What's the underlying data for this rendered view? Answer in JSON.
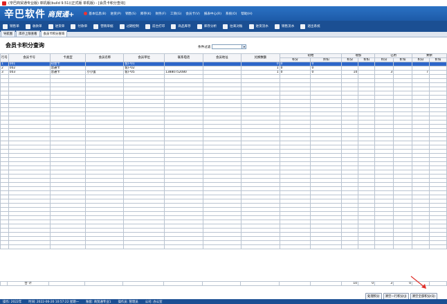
{
  "window": {
    "title": "(辛巴商贸通专业版) 单机版(build 9.51)(正式版 单机版) - [会员卡积分查询]"
  },
  "banner": {
    "logo": "辛巴软件",
    "product": "商贸通+",
    "menu": [
      "基本信息(B)",
      "进货(P)",
      "销售(S)",
      "库存(K)",
      "财务(F)",
      "工资(G)",
      "会员卡(V)",
      "报表中心(R)",
      "系统(O)",
      "帮助(H)"
    ]
  },
  "toolbar": {
    "items": [
      "销售单",
      "收款单",
      "进货单",
      "付款单",
      "营销单据",
      "过期控制",
      "前台打印",
      "商品库存",
      "库存分析",
      "往来对账",
      "进货流水",
      "销售流水",
      "退出系统"
    ]
  },
  "tabs": [
    "导航图",
    "库存上限查看",
    "会员卡积分查询"
  ],
  "page": {
    "title": "会员卡积分查询",
    "filter_label": "条件过滤",
    "filter_value": ""
  },
  "table": {
    "columns": [
      "行号",
      "会员卡号",
      "卡类型",
      "会员名称",
      "会员单位",
      "联系电话",
      "会员地址",
      "兑换数额",
      "初始",
      "增加",
      "已用",
      "剩余"
    ],
    "sub_columns": [
      "积分",
      "折扣"
    ],
    "rows": [
      {
        "no": "1",
        "card": "001",
        "type": "初会卡",
        "name": "",
        "unit": "客户01",
        "phone": "",
        "addr": "",
        "exchange": "0",
        "init_pts": "0",
        "init_disc": "0",
        "add_pts": "",
        "add_disc": "",
        "used_pts": "",
        "used_disc": "",
        "rem_pts": "",
        "rem_disc": ""
      },
      {
        "no": "2",
        "card": "002",
        "type": "普通卡",
        "name": "",
        "unit": "客户02",
        "phone": "",
        "addr": "",
        "exchange": "1",
        "init_pts": "0",
        "init_disc": "0",
        "add_pts": "",
        "add_disc": "",
        "used_pts": "",
        "used_disc": "",
        "rem_pts": "",
        "rem_disc": ""
      },
      {
        "no": "3",
        "card": "003",
        "type": "普通卡",
        "name": "小小蛋",
        "unit": "客户05",
        "phone": "13880752080",
        "addr": "",
        "exchange": "1",
        "init_pts": "0",
        "init_disc": "0",
        "add_pts": "10",
        "add_disc": "",
        "used_pts": "3",
        "used_disc": "",
        "rem_pts": "7",
        "rem_disc": ""
      }
    ],
    "total_label": "合 计",
    "totals": {
      "add_pts": "10",
      "add_disc": "0",
      "used_pts": "3",
      "used_disc": "0"
    }
  },
  "buttons": [
    "处理积分",
    "清空一行积分(J)",
    "清空全部积分(Q)"
  ],
  "statusbar": [
    "操作: 2022年",
    "时间: 2022-06-20 10:57:22 星期一",
    "账套: 商贸通专业1",
    "操作员: 管理员",
    "公司: 办公室"
  ],
  "colors": {
    "banner": "#1d5aa8",
    "toolbar": "#1b4f93",
    "selection": "#2d66c9",
    "annotation": "#e0302a"
  }
}
